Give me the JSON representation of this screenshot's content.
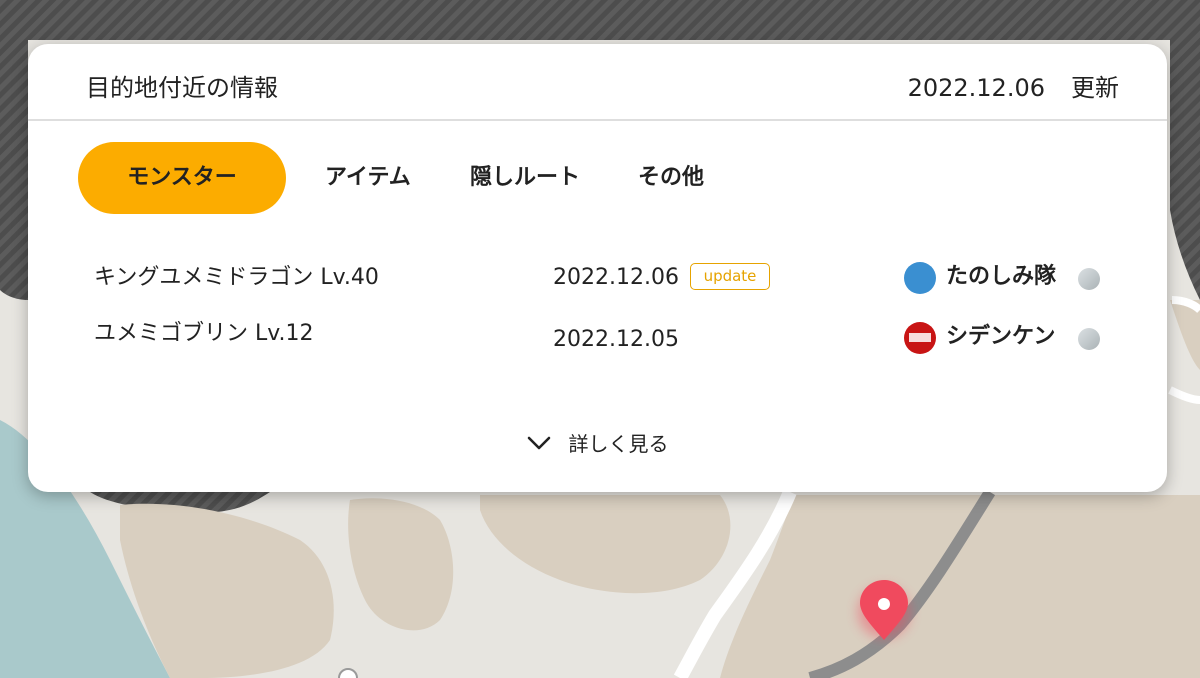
{
  "colors": {
    "accent": "#fcac00",
    "update_badge": "#e6a300",
    "pin": "#f04a5e",
    "team_blue": "#3a8fd1",
    "team_red": "#c81414"
  },
  "panel": {
    "title": "目的地付近の情報",
    "updated_date": "2022.12.06",
    "updated_label": "更新"
  },
  "tabs": [
    {
      "label": "モンスター",
      "active": true
    },
    {
      "label": "アイテム",
      "active": false
    },
    {
      "label": "隠しルート",
      "active": false
    },
    {
      "label": "その他",
      "active": false
    }
  ],
  "rows": [
    {
      "name": "キングユメミドラゴン Lv.40",
      "date": "2022.12.06",
      "badge": "update",
      "team": "たのしみ隊",
      "team_icon": "blue-circle-icon"
    },
    {
      "name": "ユメミゴブリン Lv.12",
      "date": "2022.12.05",
      "badge": "",
      "team": "シデンケン",
      "team_icon": "red-emblem-icon"
    }
  ],
  "more": {
    "label": "詳しく見る",
    "icon": "chevron-down-icon"
  },
  "map": {
    "pin_icon": "location-pin-icon"
  }
}
